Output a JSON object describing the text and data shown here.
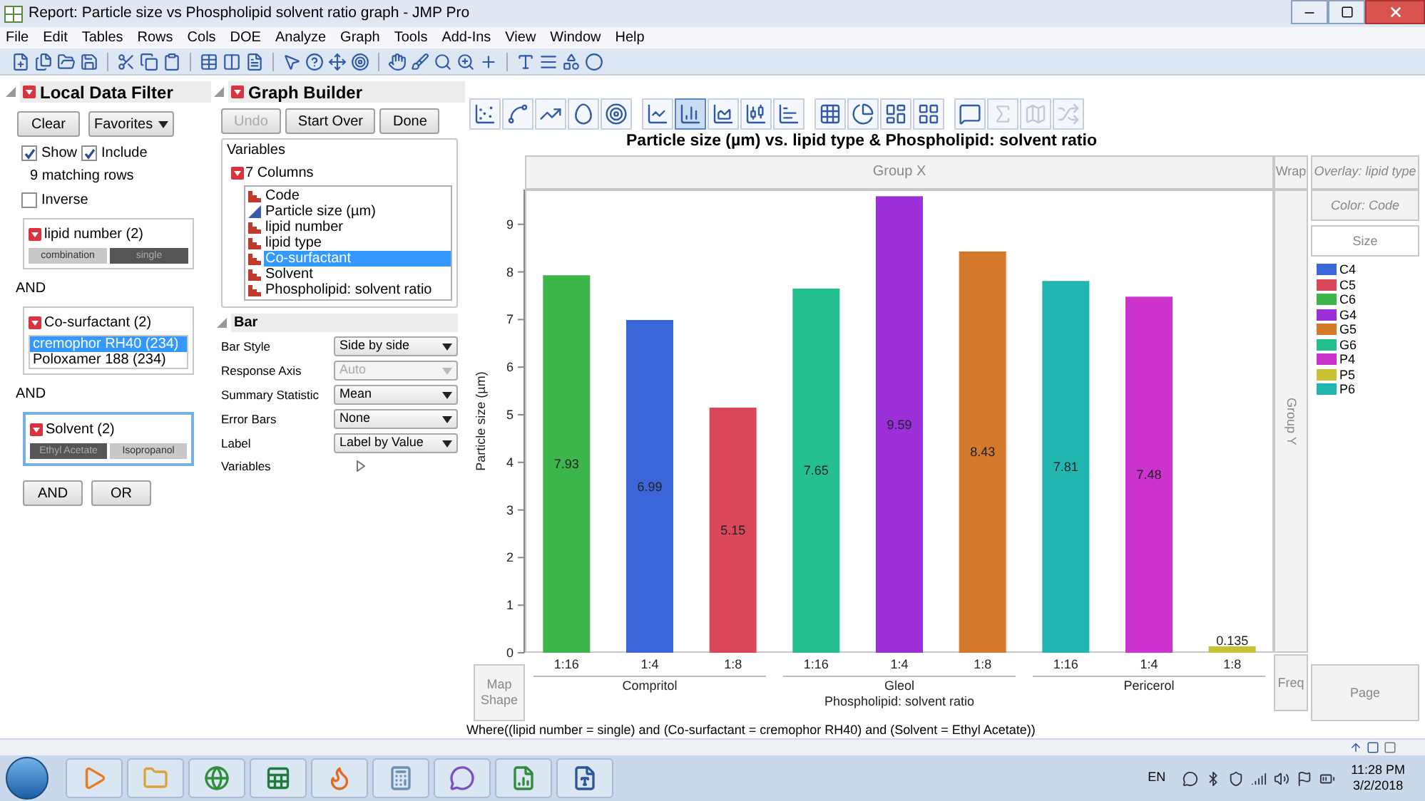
{
  "window": {
    "title": "Report: Particle size vs Phospholipid solvent ratio graph - JMP Pro"
  },
  "menu": [
    "File",
    "Edit",
    "Tables",
    "Rows",
    "Cols",
    "DOE",
    "Analyze",
    "Graph",
    "Tools",
    "Add-Ins",
    "View",
    "Window",
    "Help"
  ],
  "data_filter": {
    "title": "Local Data Filter",
    "clear": "Clear",
    "favorites": "Favorites",
    "options": [
      {
        "label": "Show",
        "checked": true
      },
      {
        "label": "Include",
        "checked": true
      }
    ],
    "matching": "9 matching rows",
    "inverse": {
      "label": "Inverse",
      "checked": false
    },
    "filters": [
      {
        "kind": "buttons",
        "title": "lipid number (2)",
        "focused": false,
        "values": [
          {
            "label": "combination",
            "selected": false
          },
          {
            "label": "single",
            "selected": true
          }
        ]
      },
      {
        "kind": "list",
        "joiner": "AND",
        "title": "Co-surfactant (2)",
        "focused": false,
        "values": [
          {
            "label": "cremophor RH40 (234)",
            "selected": true
          },
          {
            "label": "Poloxamer 188 (234)",
            "selected": false
          }
        ]
      },
      {
        "kind": "buttons",
        "joiner": "AND",
        "title": "Solvent (2)",
        "focused": true,
        "values": [
          {
            "label": "Ethyl Acetate",
            "selected": true
          },
          {
            "label": "Isopropanol",
            "selected": false
          }
        ]
      }
    ],
    "logic_buttons": [
      "AND",
      "OR"
    ]
  },
  "graph_builder": {
    "title": "Graph Builder",
    "buttons": [
      {
        "label": "Undo",
        "disabled": true
      },
      {
        "label": "Start Over",
        "disabled": false
      },
      {
        "label": "Done",
        "disabled": false
      }
    ],
    "variables": {
      "title": "Variables",
      "count": "7 Columns",
      "columns": [
        {
          "name": "Code",
          "kind": "nominal",
          "selected": false
        },
        {
          "name": "Particle size (µm)",
          "kind": "continuous",
          "selected": false
        },
        {
          "name": "lipid number",
          "kind": "nominal",
          "selected": false
        },
        {
          "name": "lipid type",
          "kind": "nominal",
          "selected": false
        },
        {
          "name": "Co-surfactant",
          "kind": "nominal",
          "selected": true
        },
        {
          "name": "Solvent",
          "kind": "nominal",
          "selected": false
        },
        {
          "name": "Phospholipid: solvent ratio",
          "kind": "nominal",
          "selected": false
        }
      ]
    },
    "element": {
      "title": "Bar",
      "settings": [
        {
          "label": "Bar Style",
          "value": "Side by side",
          "disabled": false
        },
        {
          "label": "Response Axis",
          "value": "Auto",
          "disabled": true
        },
        {
          "label": "Summary Statistic",
          "value": "Mean",
          "disabled": false
        },
        {
          "label": "Error Bars",
          "value": "None",
          "disabled": false
        },
        {
          "label": "Label",
          "value": "Label by Value",
          "disabled": false
        }
      ],
      "variables_label": "Variables"
    }
  },
  "elements": [
    {
      "kind": "points",
      "selected": false,
      "disabled": false
    },
    {
      "kind": "smoother",
      "selected": false,
      "disabled": false
    },
    {
      "kind": "line_fit",
      "selected": false,
      "disabled": false
    },
    {
      "kind": "ellipse",
      "selected": false,
      "disabled": false
    },
    {
      "kind": "contour",
      "selected": false,
      "disabled": false
    },
    {
      "kind": "line",
      "selected": false,
      "disabled": false
    },
    {
      "kind": "bar",
      "selected": true,
      "disabled": false
    },
    {
      "kind": "area",
      "selected": false,
      "disabled": false
    },
    {
      "kind": "box",
      "selected": false,
      "disabled": false
    },
    {
      "kind": "histogram",
      "selected": false,
      "disabled": false
    },
    {
      "kind": "heatmap",
      "selected": false,
      "disabled": false
    },
    {
      "kind": "pie",
      "selected": false,
      "disabled": false
    },
    {
      "kind": "treemap",
      "selected": false,
      "disabled": false
    },
    {
      "kind": "mosaic",
      "selected": false,
      "disabled": false
    },
    {
      "kind": "caption",
      "selected": false,
      "disabled": false
    },
    {
      "kind": "formula",
      "selected": false,
      "disabled": true
    },
    {
      "kind": "map",
      "selected": false,
      "disabled": true
    },
    {
      "kind": "parallel",
      "selected": false,
      "disabled": true
    }
  ],
  "graph": {
    "title": "Particle size (µm) vs. lipid type & Phospholipid: solvent ratio",
    "zones": {
      "group_x": "Group X",
      "wrap": "Wrap",
      "overlay": "Overlay: lipid type",
      "color_zone": "Color: Code",
      "size": "Size",
      "group_y": "Group Y",
      "map_shape": "Map Shape",
      "freq": "Freq",
      "page": "Page"
    },
    "x_groups": [
      "Compritol",
      "Gleol",
      "Pericerol"
    ],
    "chart_data": {
      "type": "bar",
      "xlabel": "Phospholipid: solvent ratio",
      "ylabel": "Particle size (µm)",
      "categories": [
        "1:16",
        "1:4",
        "1:8",
        "1:16",
        "1:4",
        "1:8",
        "1:16",
        "1:4",
        "1:8"
      ],
      "series": [
        {
          "name": "C4",
          "color": "#3a66d8",
          "values": [
            null,
            6.99,
            null,
            null,
            null,
            null,
            null,
            null,
            null
          ]
        },
        {
          "name": "C5",
          "color": "#d8475a",
          "values": [
            null,
            null,
            5.15,
            null,
            null,
            null,
            null,
            null,
            null
          ]
        },
        {
          "name": "C6",
          "color": "#3cb54a",
          "values": [
            7.93,
            null,
            null,
            null,
            null,
            null,
            null,
            null,
            null
          ]
        },
        {
          "name": "G4",
          "color": "#9b30d9",
          "values": [
            null,
            null,
            null,
            null,
            9.59,
            null,
            null,
            null,
            null
          ]
        },
        {
          "name": "G5",
          "color": "#d4782a",
          "values": [
            null,
            null,
            null,
            null,
            null,
            8.43,
            null,
            null,
            null
          ]
        },
        {
          "name": "G6",
          "color": "#23bf8f",
          "values": [
            null,
            null,
            null,
            7.65,
            null,
            null,
            null,
            null,
            null
          ]
        },
        {
          "name": "P4",
          "color": "#cc33cc",
          "values": [
            null,
            null,
            null,
            null,
            null,
            null,
            null,
            7.48,
            null
          ]
        },
        {
          "name": "P5",
          "color": "#c9c234",
          "values": [
            null,
            null,
            null,
            null,
            null,
            null,
            null,
            null,
            0.135
          ]
        },
        {
          "name": "P6",
          "color": "#22b5b0",
          "values": [
            null,
            null,
            null,
            null,
            null,
            null,
            7.81,
            null,
            null
          ]
        }
      ],
      "ylim": [
        0,
        9.73
      ],
      "yticks": [
        0,
        1,
        2,
        3,
        4,
        5,
        6,
        7,
        8,
        9
      ],
      "data_labels": true
    },
    "where": "Where((lipid number = single) and (Co-surfactant = cremophor RH40) and (Solvent = Ethyl Acetate))"
  },
  "taskbar": {
    "language": "EN",
    "time": "11:28 PM",
    "date": "3/2/2018"
  }
}
